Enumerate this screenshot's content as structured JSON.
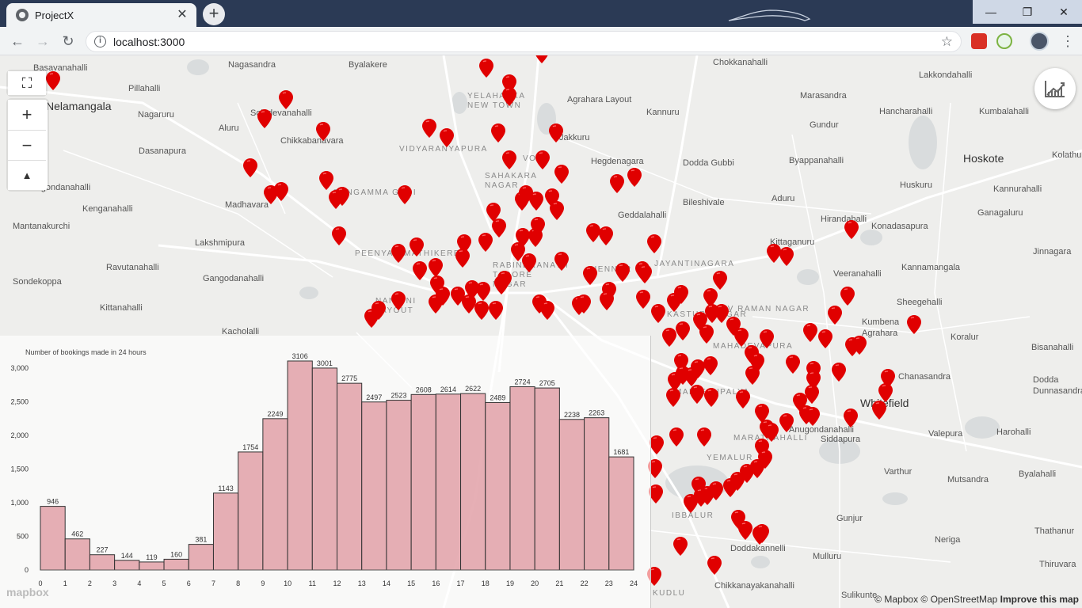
{
  "browser": {
    "tab_title": "ProjectX",
    "tab_close": "✕",
    "new_tab": "+",
    "url": "localhost:3000",
    "back": "←",
    "forward": "→",
    "reload": "↻",
    "bookmark": "☆",
    "menu": "⋮",
    "window_min": "—",
    "window_max": "❐",
    "window_close": "✕"
  },
  "map": {
    "controls": {
      "zoom_in": "+",
      "zoom_out": "−",
      "compass": "▲",
      "fullscreen": "⛶"
    },
    "attribution": "© Mapbox © OpenStreetMap",
    "improve": "Improve this map",
    "logo": "mapbox",
    "places": [
      "Basavanahalli",
      "Nagasandra",
      "Byalakere",
      "Chokkanahalli",
      "Lakkondahalli",
      "Pillahalli",
      "Yelahanka New Town",
      "Agrahara Layout",
      "Marasandra",
      "Nelamangala",
      "Soladevanahalli",
      "Kannuru",
      "Hancharahalli",
      "Kumbalahalli",
      "Nagaruru",
      "Aluru",
      "Gundur",
      "Chikkabanavara",
      "Vidyaranyapura",
      "Jakkuru",
      "Dasanapura",
      "Vojk",
      "Hegdenagara",
      "Dodda Gubbi",
      "Byappanahalli",
      "Hoskote",
      "Sahakara Nagar",
      "Kolathur",
      "Bhairagondanahalli",
      "Huskuru",
      "Kannurahalli",
      "Madhavara",
      "Gangamma Gudi",
      "Bileshivale",
      "Aduru",
      "Kenganahalli",
      "Geddalahalli",
      "Hirandahalli",
      "Ganagaluru",
      "Mantanakurchi",
      "Konadasapura",
      "Lakshmipura",
      "Kittaganuru",
      "Jinnagara",
      "Peenya",
      "Mathikere",
      "Hennur",
      "Jayantinagara",
      "Ravutanahalli",
      "Rabindranath Tagore Nagar",
      "Kannamangala",
      "Gangodanahalli",
      "Veeranahalli",
      "Sondekoppa",
      "Nandini Layout",
      "Sheegehalli",
      "Kittanahalli",
      "Kasturi Nagar",
      "CV Raman Nagar",
      "Kumbena Agrahara",
      "Koralur",
      "Kacholalli",
      "Mahadevapura",
      "Bisanahalli",
      "Chanasandra",
      "Dodda Dunnasandra",
      "Malleshpalya",
      "Whitefield",
      "Varthur",
      "Valepura",
      "Harohalli",
      "Anugondanahalli",
      "Siddapura",
      "Yemalur",
      "Marathahalli",
      "Mutsandra",
      "Byalahalli",
      "Gunjur",
      "Neriga",
      "Thathanur",
      "Doddakannelli",
      "Mulluru",
      "Thiruvara",
      "Chikkanayakanahalli",
      "Sulikunte",
      "Ibbalur",
      "Kudlu"
    ],
    "pin_color": "#e00000"
  },
  "chart_data": {
    "type": "bar",
    "title": "Number of bookings made in 24 hours",
    "xlabel": "",
    "ylabel": "",
    "categories": [
      "0",
      "1",
      "2",
      "3",
      "4",
      "5",
      "6",
      "7",
      "8",
      "9",
      "10",
      "11",
      "12",
      "13",
      "14",
      "15",
      "16",
      "17",
      "18",
      "19",
      "20",
      "21",
      "22",
      "23"
    ],
    "x_ticks": [
      "0",
      "1",
      "2",
      "3",
      "4",
      "5",
      "6",
      "7",
      "8",
      "9",
      "10",
      "11",
      "12",
      "13",
      "14",
      "15",
      "16",
      "17",
      "18",
      "19",
      "20",
      "21",
      "22",
      "23",
      "24"
    ],
    "values": [
      946,
      462,
      227,
      144,
      119,
      160,
      381,
      1143,
      1754,
      2249,
      3106,
      3001,
      2775,
      2497,
      2523,
      2608,
      2614,
      2622,
      2489,
      2724,
      2705,
      2238,
      2263,
      1681
    ],
    "y_ticks": [
      "0",
      "500",
      "1,000",
      "1,500",
      "2,000",
      "2,500",
      "3,000"
    ],
    "ylim": [
      0,
      3200
    ],
    "bar_color": "#e2a1a8",
    "bar_edge": "#333333",
    "grid": false
  }
}
